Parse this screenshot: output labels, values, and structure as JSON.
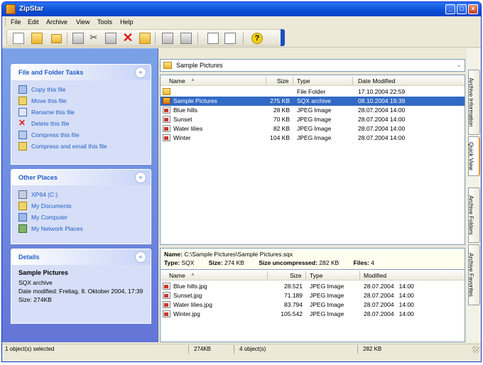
{
  "app": {
    "title": "ZipStar"
  },
  "window_buttons": {
    "min": "_",
    "max": "□",
    "close": "×"
  },
  "menu": [
    "File",
    "Edit",
    "Archive",
    "View",
    "Tools",
    "Help"
  ],
  "toolbar": {
    "icons": [
      "new-archive-icon",
      "open-folder-icon",
      "extract-icon",
      "copy-icon",
      "cut-icon",
      "paste-icon",
      "delete-icon",
      "compress-icon",
      "split-icon",
      "join-icon",
      "view-icon",
      "edit-icon",
      "help-icon"
    ],
    "help_glyph": "?",
    "cut_glyph": "✂",
    "delete_glyph": "✕"
  },
  "panels": {
    "tasks": {
      "title": "File and Folder Tasks",
      "items": [
        "Copy this file",
        "Move this file",
        "Rename this file",
        "Delete this file",
        "Compress this file",
        "Compress and email this file"
      ]
    },
    "places": {
      "title": "Other Places",
      "items": [
        "XP64 (C:)",
        "My Documents",
        "My Computer",
        "My Network Places"
      ]
    },
    "details": {
      "title": "Details",
      "name": "Sample Pictures",
      "type": "SQX archive",
      "modified": "Date modified: Freitag, 8. Oktober 2004, 17:39",
      "size": "Size: 274KB"
    },
    "collapse_glyph": "«"
  },
  "address": {
    "value": "Sample Pictures",
    "drop_glyph": "⌄"
  },
  "list1": {
    "headers": {
      "name": "Name",
      "sort": "▲",
      "size": "Size",
      "type": "Type",
      "date": "Date Modified"
    },
    "rows": [
      {
        "icon": "folder",
        "name": "",
        "size": "",
        "type": "File Folder",
        "date": "17.10.2004 22:59",
        "selected": false
      },
      {
        "icon": "sqx",
        "name": "Sample Pictures",
        "size": "275 KB",
        "type": "SQX archive",
        "date": "08.10.2004 19:39",
        "selected": true
      },
      {
        "icon": "jpg",
        "name": "Blue hills",
        "size": "28 KB",
        "type": "JPEG Image",
        "date": "28.07.2004 14:00",
        "selected": false
      },
      {
        "icon": "jpg",
        "name": "Sunset",
        "size": "70 KB",
        "type": "JPEG Image",
        "date": "28.07.2004 14:00",
        "selected": false
      },
      {
        "icon": "jpg",
        "name": "Water lilies",
        "size": "82 KB",
        "type": "JPEG Image",
        "date": "28.07.2004 14:00",
        "selected": false
      },
      {
        "icon": "jpg",
        "name": "Winter",
        "size": "104 KB",
        "type": "JPEG Image",
        "date": "28.07.2004 14:00",
        "selected": false
      }
    ]
  },
  "archive_info": {
    "name_label": "Name:",
    "name_value": "C:\\Sample Pictures\\Sample Pictures.sqx",
    "type_label": "Type:",
    "type_value": "SQX",
    "size_label": "Size:",
    "size_value": "274 KB",
    "uncomp_label": "Size uncompressed:",
    "uncomp_value": "282 KB",
    "files_label": "Files:",
    "files_value": "4"
  },
  "list2": {
    "headers": {
      "name": "Name",
      "sort": "▲",
      "size": "Size",
      "type": "Type",
      "date": "Modified"
    },
    "rows": [
      {
        "name": "Blue hills.jpg",
        "size": "28.521",
        "type": "JPEG Image",
        "date": "28.07.2004   14:00"
      },
      {
        "name": "Sunset.jpg",
        "size": "71.189",
        "type": "JPEG Image",
        "date": "28.07.2004   14:00"
      },
      {
        "name": "Water lilies.jpg",
        "size": "83.794",
        "type": "JPEG Image",
        "date": "28.07.2004   14:00"
      },
      {
        "name": "Winter.jpg",
        "size": "105.542",
        "type": "JPEG Image",
        "date": "28.07.2004   14:00"
      }
    ]
  },
  "side_tabs": [
    "Archive Information",
    "Quick View",
    "Archive Folders",
    "Archive Favorites"
  ],
  "status": {
    "selected": "1 object(s) selected",
    "size": "274KB",
    "objects": "4 object(s)",
    "total": "282 KB"
  }
}
